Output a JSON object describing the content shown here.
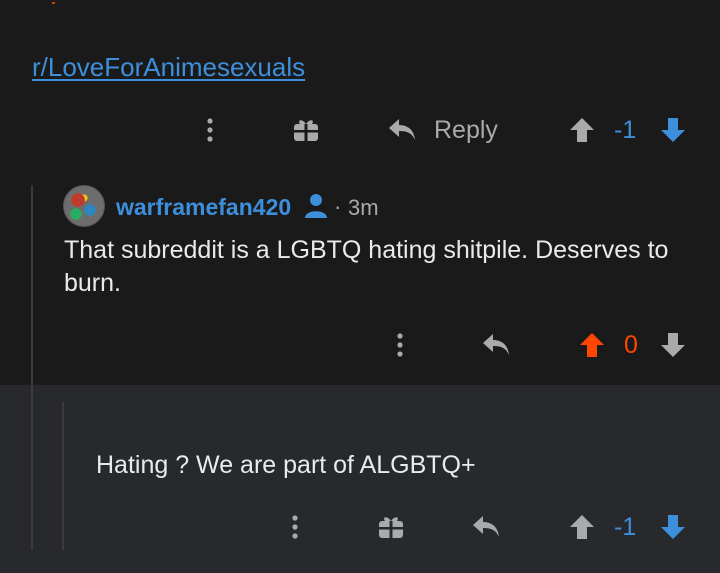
{
  "subreddit_link": "r/LoveForAnimesexuals",
  "parent_actions": {
    "reply_label": "Reply",
    "score": "-1"
  },
  "comment": {
    "username": "warframefan420",
    "dot": "·",
    "time": "3m",
    "body": "That subreddit is a LGBTQ hating shitpile. Deserves to burn.",
    "score": "0"
  },
  "reply_comment": {
    "body": "Hating ? We are part of ALGBTQ+",
    "score": "-1"
  },
  "colors": {
    "background": "#1a1a1b",
    "highlight_background": "#27292d",
    "link_blue": "#3d8fdb",
    "upvote_orange": "#ff4500",
    "icon_gray": "#a8aaab"
  }
}
